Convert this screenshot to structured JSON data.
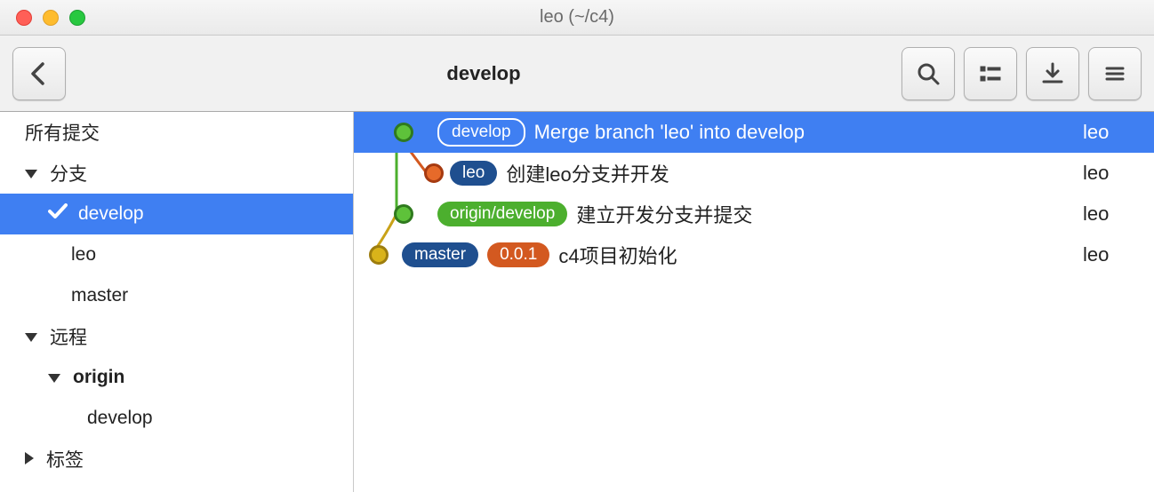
{
  "window": {
    "title": "leo (~/c4)"
  },
  "toolbar": {
    "title": "develop"
  },
  "sidebar": {
    "all_commits": "所有提交",
    "branches_section": "分支",
    "branches": [
      {
        "name": "develop",
        "selected": true,
        "current": true
      },
      {
        "name": "leo"
      },
      {
        "name": "master"
      }
    ],
    "remotes_section": "远程",
    "remotes": [
      {
        "name": "origin",
        "branches": [
          {
            "name": "develop"
          }
        ]
      }
    ],
    "tags_section": "标签"
  },
  "commits": [
    {
      "selected": true,
      "refs": [
        {
          "label": "develop",
          "style": "outline"
        }
      ],
      "message": "Merge branch 'leo' into develop",
      "author": "leo"
    },
    {
      "refs": [
        {
          "label": "leo",
          "style": "blue"
        }
      ],
      "message": "创建leo分支并开发",
      "author": "leo"
    },
    {
      "refs": [
        {
          "label": "origin/develop",
          "style": "green"
        }
      ],
      "message": "建立开发分支并提交",
      "author": "leo"
    },
    {
      "refs": [
        {
          "label": "master",
          "style": "blue"
        },
        {
          "label": "0.0.1",
          "style": "orange"
        }
      ],
      "message": "c4项目初始化",
      "author": "leo"
    }
  ]
}
